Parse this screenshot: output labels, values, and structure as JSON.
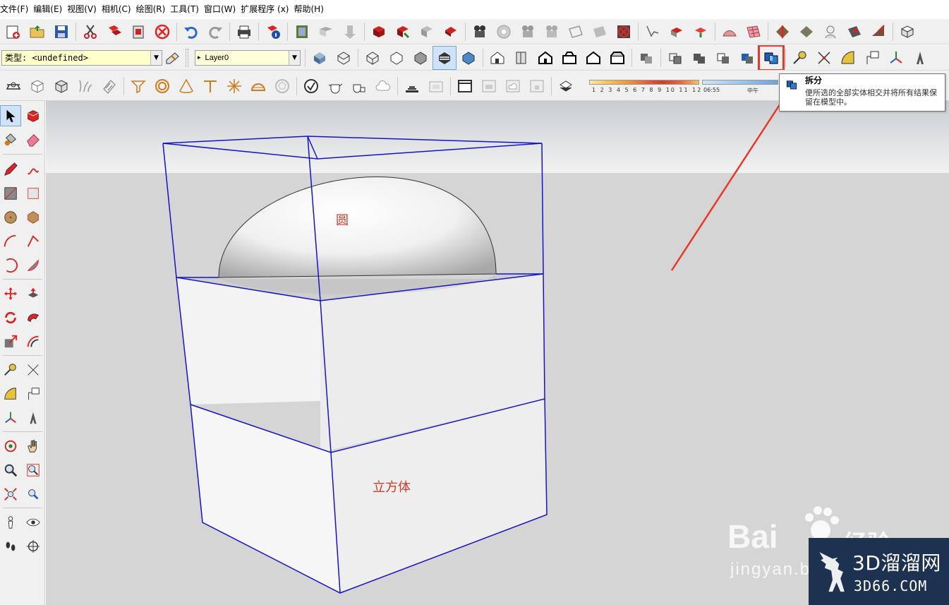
{
  "menubar": {
    "items": [
      "文件(F)",
      "编辑(E)",
      "视图(V)",
      "相机(C)",
      "绘图(R)",
      "工具(T)",
      "窗口(W)",
      "扩展程序 (x)",
      "帮助(H)"
    ]
  },
  "entity_info": {
    "type_label": "类型: <undefined>"
  },
  "layer": {
    "current": "Layer0"
  },
  "shadow": {
    "months": "1 2 3 4 5 6 7 8 9 10 11 12",
    "time_start": "06:55",
    "time_mid": "中午"
  },
  "tooltip": {
    "title": "拆分",
    "body": "便所选的全部实体相交并将所有结果保留在模型中。"
  },
  "scene": {
    "sphere_label": "圆",
    "cube_label": "立方体"
  },
  "watermark": {
    "baidu_text": "Bai",
    "baidu_suffix": "经验",
    "jingyan": "jingyan.b",
    "site_title": "3D溜溜网",
    "site_domain": "3D66.COM"
  },
  "colors": {
    "highlight": "#e53a2a",
    "selection_edges": "#1414c8",
    "annotation_text": "#d23a2a",
    "watermark_bg": "#1d3150"
  }
}
